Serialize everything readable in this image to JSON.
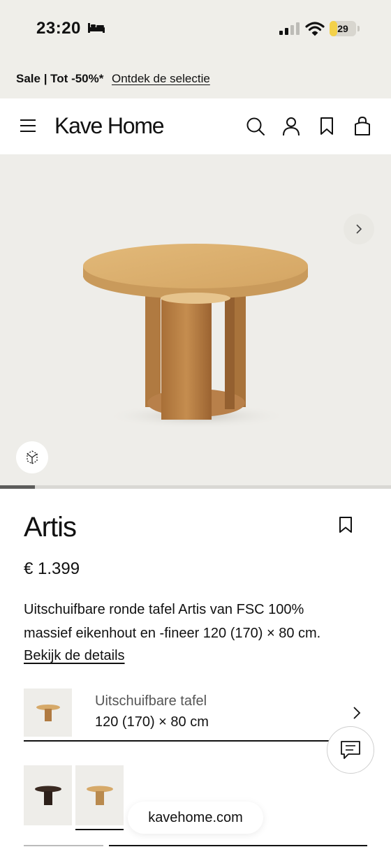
{
  "status_bar": {
    "time": "23:20",
    "battery_level": 29,
    "battery_text": "29",
    "icons": [
      "bed-icon",
      "signal-icon",
      "wifi-icon",
      "battery-icon"
    ],
    "battery_color": "#f3d14a"
  },
  "promo": {
    "text": "Sale | Tot -50%*",
    "link": "Ontdek de selectie"
  },
  "header": {
    "logo": "Kave Home",
    "icons": [
      "menu-icon",
      "search-icon",
      "account-icon",
      "wishlist-icon",
      "cart-icon"
    ]
  },
  "gallery": {
    "slide_progress": 0.09,
    "background_color": "#eeede9",
    "icons": [
      "chevron-right-icon",
      "view-360-icon"
    ]
  },
  "product": {
    "title": "Artis",
    "price": "€ 1.399",
    "description": "Uitschuifbare ronde tafel Artis van FSC 100% massief eikenhout en -fineer 120 (170) × 80 cm.",
    "details_link": "Bekijk de details"
  },
  "variant": {
    "label": "Uitschuifbare tafel",
    "value": "120 (170) × 80 cm"
  },
  "swatches": [
    {
      "color": "#3a2a22",
      "selected": false
    },
    {
      "color": "#b98a4e",
      "selected": true
    }
  ],
  "browser": {
    "url": "kavehome.com"
  }
}
